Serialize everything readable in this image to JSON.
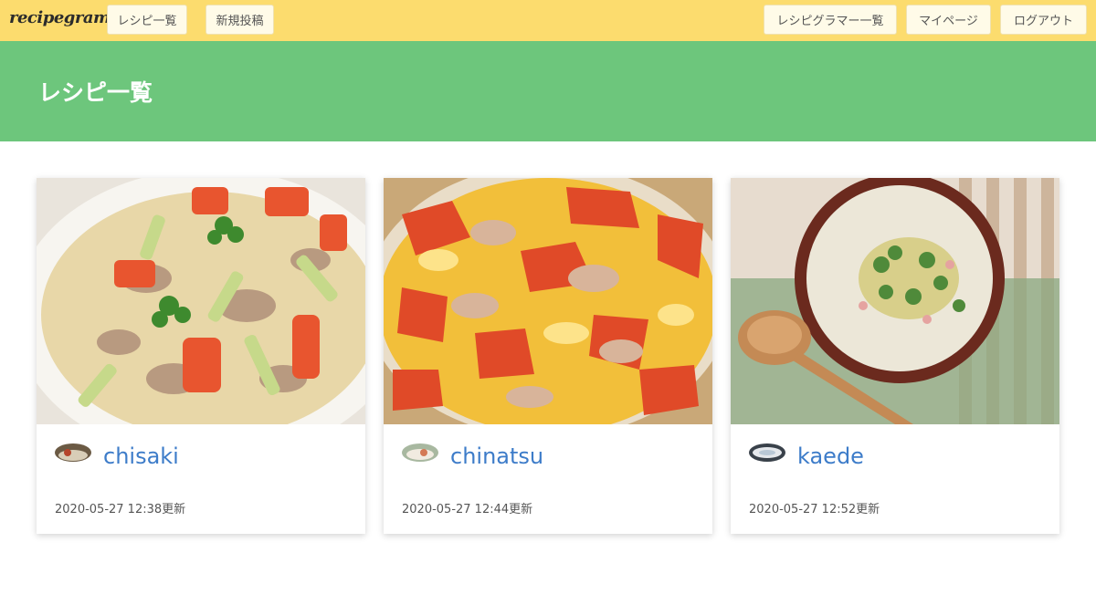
{
  "navbar": {
    "brand": "recipegram",
    "left_links": [
      "レシピ一覧",
      "新規投稿"
    ],
    "right_links": [
      "レシピグラマー一覧",
      "マイページ",
      "ログアウト"
    ],
    "background": "#fcdc6e"
  },
  "hero": {
    "title": "レシピ一覧",
    "background": "#6dc67c"
  },
  "recipes": [
    {
      "user": "chisaki",
      "updated": "2020-05-27 12:38更新",
      "image": "pork-leek-tomato-stirfry-photo"
    },
    {
      "user": "chinatsu",
      "updated": "2020-05-27 12:44更新",
      "image": "tomato-egg-stirfry-photo"
    },
    {
      "user": "kaede",
      "updated": "2020-05-27 12:52更新",
      "image": "broccoli-cream-soup-photo"
    }
  ],
  "colors": {
    "link": "#3d7cc9"
  }
}
